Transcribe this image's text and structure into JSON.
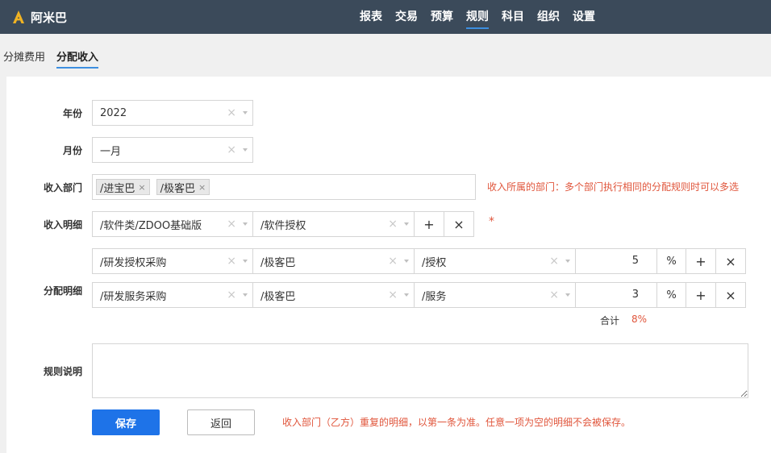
{
  "app": {
    "title": "阿米巴",
    "logo_icon": "amiba-logo",
    "accent": "#f0b323"
  },
  "nav": [
    {
      "label": "报表",
      "active": false
    },
    {
      "label": "交易",
      "active": false
    },
    {
      "label": "预算",
      "active": false
    },
    {
      "label": "规则",
      "active": true
    },
    {
      "label": "科目",
      "active": false
    },
    {
      "label": "组织",
      "active": false
    },
    {
      "label": "设置",
      "active": false
    }
  ],
  "subtabs": [
    {
      "label": "分摊费用",
      "active": false
    },
    {
      "label": "分配收入",
      "active": true
    }
  ],
  "form": {
    "year_label": "年份",
    "year_value": "2022",
    "month_label": "月份",
    "month_value": "一月",
    "dept_label": "收入部门",
    "dept_tags": [
      "/进宝巴",
      "/极客巴"
    ],
    "dept_hint": "收入所属的部门：多个部门执行相同的分配规则时可以多选",
    "detail_label": "收入明细",
    "detail_product": "/软件类/ZDOO基础版",
    "detail_subject": "/软件授权",
    "required_mark": "*",
    "alloc_label": "分配明细",
    "alloc_rows": [
      {
        "subject": "/研发授权采购",
        "dept": "/极客巴",
        "item": "/授权",
        "value": "5",
        "unit": "%"
      },
      {
        "subject": "/研发服务采购",
        "dept": "/极客巴",
        "item": "/服务",
        "value": "3",
        "unit": "%"
      }
    ],
    "total_label": "合计",
    "total_value": "8%",
    "desc_label": "规则说明",
    "desc_value": "",
    "save_label": "保存",
    "back_label": "返回",
    "footer_hint": "收入部门（乙方）重复的明细，以第一条为准。任意一项为空的明细不会被保存。",
    "add_symbol": "+",
    "remove_symbol": "×",
    "clear_symbol": "×"
  },
  "colors": {
    "topbar": "#3b4a5a",
    "primary": "#1e73e8",
    "hint": "#e0553b"
  }
}
